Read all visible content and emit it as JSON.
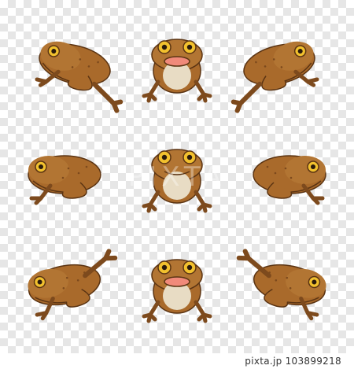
{
  "credit": {
    "site": "pixta.jp",
    "id": "103899218"
  },
  "watermark": {
    "text": "PIXTA"
  },
  "colors": {
    "body": "#a96a2b",
    "bodyDark": "#7d4a1d",
    "outline": "#5b3413",
    "belly": "#e8dcc4",
    "mouth": "#f08a7a",
    "eye": "#f2c12e"
  },
  "poses": [
    "leap-left",
    "front-open-mouth",
    "leap-right",
    "sit-left",
    "front",
    "sit-right",
    "jump-left",
    "front-open-mouth",
    "jump-right"
  ]
}
